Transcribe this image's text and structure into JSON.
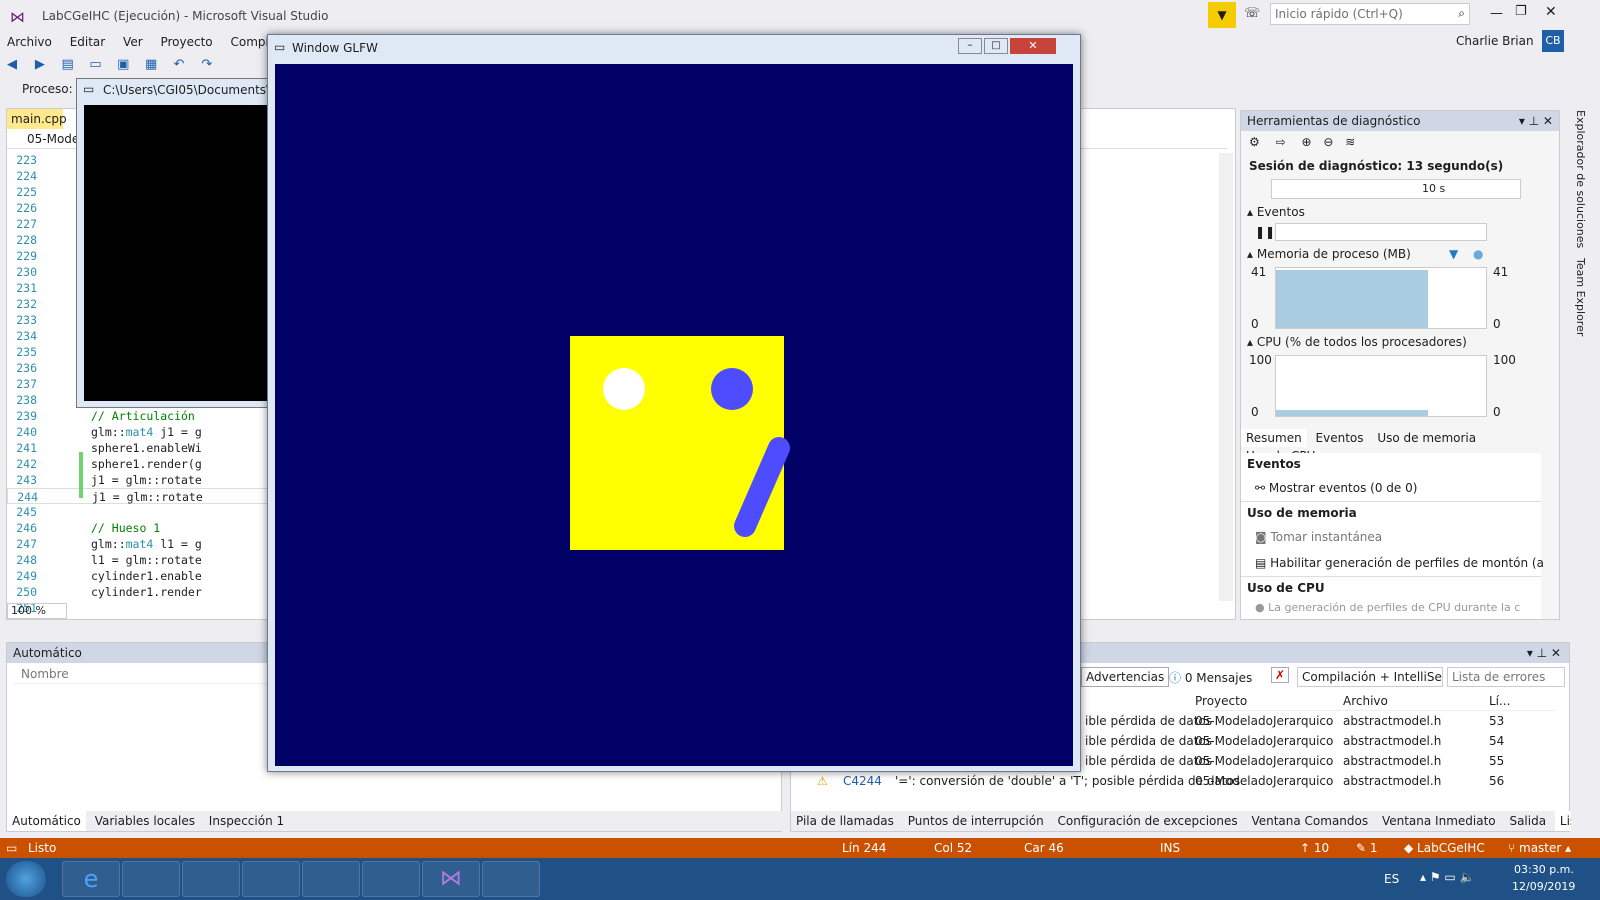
{
  "vs": {
    "title": "LabCGeIHC (Ejecución) - Microsoft Visual Studio",
    "quick_launch_placeholder": "Inicio rápido (Ctrl+Q)",
    "user": "Charlie Brian",
    "user_initials": "CB",
    "menu": [
      "Archivo",
      "Editar",
      "Ver",
      "Proyecto",
      "Compil"
    ],
    "process_label": "Proceso:",
    "console_title": "C:\\Users\\CGI05\\Documents\\C",
    "editor_tab": "main.cpp",
    "editor_nav": "05-Mode",
    "zoom": "100 %"
  },
  "code": {
    "line_numbers": [
      "223",
      "224",
      "225",
      "226",
      "227",
      "228",
      "229",
      "230",
      "231",
      "232",
      "233",
      "234",
      "235",
      "236",
      "237",
      "238",
      "239",
      "240",
      "241",
      "242",
      "243",
      "244",
      "245",
      "246",
      "247",
      "248",
      "249",
      "250",
      "251"
    ],
    "lines": [
      {
        "n": "239",
        "text": "// Articulación",
        "type": "comment"
      },
      {
        "n": "240",
        "pre": "glm::",
        "kw": "mat4",
        "text": " j1 = g"
      },
      {
        "n": "241",
        "text": "sphere1.enableWi"
      },
      {
        "n": "242",
        "text": "sphere1.render(g"
      },
      {
        "n": "243",
        "text": "j1 = glm::rotate"
      },
      {
        "n": "244",
        "text": "j1 = glm::rotate"
      },
      {
        "n": "245",
        "text": ""
      },
      {
        "n": "246",
        "text": "// Hueso 1",
        "type": "comment"
      },
      {
        "n": "247",
        "pre": "glm::",
        "kw": "mat4",
        "text": " l1 = g"
      },
      {
        "n": "248",
        "text": "l1 = glm::rotate"
      },
      {
        "n": "249",
        "text": "cylinder1.enable"
      },
      {
        "n": "250",
        "text": "cylinder1.render"
      },
      {
        "n": "251",
        "text": ""
      }
    ]
  },
  "glfw": {
    "title": "Window GLFW",
    "bg": "#000066",
    "square": "#ffff00",
    "eye_left": "#ffffff",
    "eye_right": "#4d4dff",
    "bone": "#4d4dff"
  },
  "diag": {
    "title": "Herramientas de diagnóstico",
    "session": "Sesión de diagnóstico: 13 segundo(s)",
    "timeline_mark": "10 s",
    "events_label": "Eventos",
    "memory_label": "Memoria de proceso (MB)",
    "mem_max": "41",
    "mem_min": "0",
    "cpu_label": "CPU (% de todos los procesadores)",
    "cpu_max": "100",
    "cpu_min": "0",
    "tabs": [
      "Resumen",
      "Eventos",
      "Uso de memoria",
      "Uso de CPU"
    ],
    "events_heading": "Eventos",
    "show_events": "Mostrar eventos (0 de 0)",
    "memory_heading": "Uso de memoria",
    "snapshot": "Tomar instantánea",
    "heap_profiling": "Habilitar generación de perfiles de montón (a",
    "cpu_heading": "Uso de CPU",
    "cpu_note": "La generación de perfiles de CPU durante la c"
  },
  "side_tabs": [
    "Explorador de soluciones",
    "Team Explorer"
  ],
  "autos": {
    "title": "Automático",
    "column_name": "Nombre",
    "bottom_tabs": [
      "Automático",
      "Variables locales",
      "Inspección 1"
    ]
  },
  "errors": {
    "warnings": "Advertencias",
    "messages": "0 Mensajes",
    "scope": "Compilación + IntelliSen",
    "search_placeholder": "Lista de errores",
    "columns": [
      "Proyecto",
      "Archivo",
      "Lí..."
    ],
    "rows": [
      {
        "desc": "ible pérdida de datos",
        "project": "05-ModeladoJerarquico",
        "file": "abstractmodel.h",
        "line": "53"
      },
      {
        "desc": "ible pérdida de datos",
        "project": "05-ModeladoJerarquico",
        "file": "abstractmodel.h",
        "line": "54"
      },
      {
        "desc": "ible pérdida de datos",
        "project": "05-ModeladoJerarquico",
        "file": "abstractmodel.h",
        "line": "55"
      },
      {
        "code": "C4244",
        "desc": "'=': conversión de 'double' a 'T'; posible pérdida de datos",
        "project": "05-ModeladoJerarquico",
        "file": "abstractmodel.h",
        "line": "56"
      }
    ],
    "bottom_tabs": [
      "Pila de llamadas",
      "Puntos de interrupción",
      "Configuración de excepciones",
      "Ventana Comandos",
      "Ventana Inmediato",
      "Salida",
      "Lista de errores"
    ]
  },
  "status": {
    "ready": "Listo",
    "line": "Lín 244",
    "col": "Col 52",
    "car": "Car 46",
    "ins": "INS",
    "up_count": "10",
    "edit_count": "1",
    "repo": "LabCGeIHC",
    "branch": "master"
  },
  "taskbar": {
    "lang": "ES",
    "time": "03:30 p.m.",
    "date": "12/09/2019"
  }
}
